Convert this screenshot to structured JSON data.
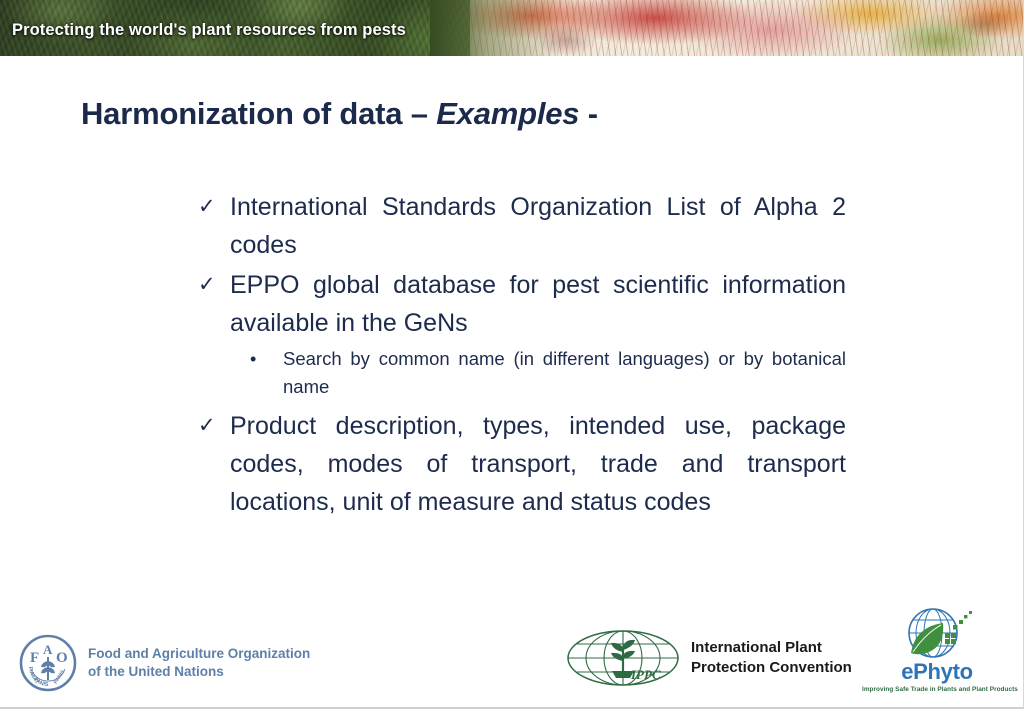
{
  "banner": {
    "tagline": "Protecting the world's plant resources from pests"
  },
  "title": {
    "main": "Harmonization of data – ",
    "emphasis": "Examples",
    "suffix": " -"
  },
  "content": {
    "bullets": [
      {
        "marker": "✓",
        "text": "International Standards Organization List of Alpha 2 codes",
        "subbullets": []
      },
      {
        "marker": "✓",
        "text": "EPPO global database for pest scientific information available in the GeNs",
        "subbullets": [
          {
            "marker": "•",
            "text": "Search by common name (in different languages) or by botanical name"
          }
        ]
      },
      {
        "marker": "✓",
        "text": "Product description, types, intended use, package codes, modes of transport, trade and transport locations, unit of measure and status codes",
        "subbullets": []
      }
    ]
  },
  "footer": {
    "fao": {
      "emblem_letters": [
        "F",
        "A",
        "O"
      ],
      "motto": "FIAT PANIS",
      "line1": "Food and Agriculture Organization",
      "line2": "of the United Nations"
    },
    "ippc": {
      "emblem_text": "IPPC",
      "line1": "International Plant",
      "line2": "Protection Convention"
    },
    "ephyto": {
      "name_prefix": "e",
      "name_suffix": "Phyto",
      "tagline": "Improving Safe Trade in Plants and Plant Products"
    }
  },
  "colors": {
    "title_navy": "#1b2a4a",
    "body_navy": "#1d2b4d",
    "fao_blue": "#5d7fa8",
    "ippc_green": "#2f6b42",
    "ephyto_blue": "#2e75b6",
    "ephyto_green": "#3f8f3f",
    "banner_text": "#ffffff"
  }
}
